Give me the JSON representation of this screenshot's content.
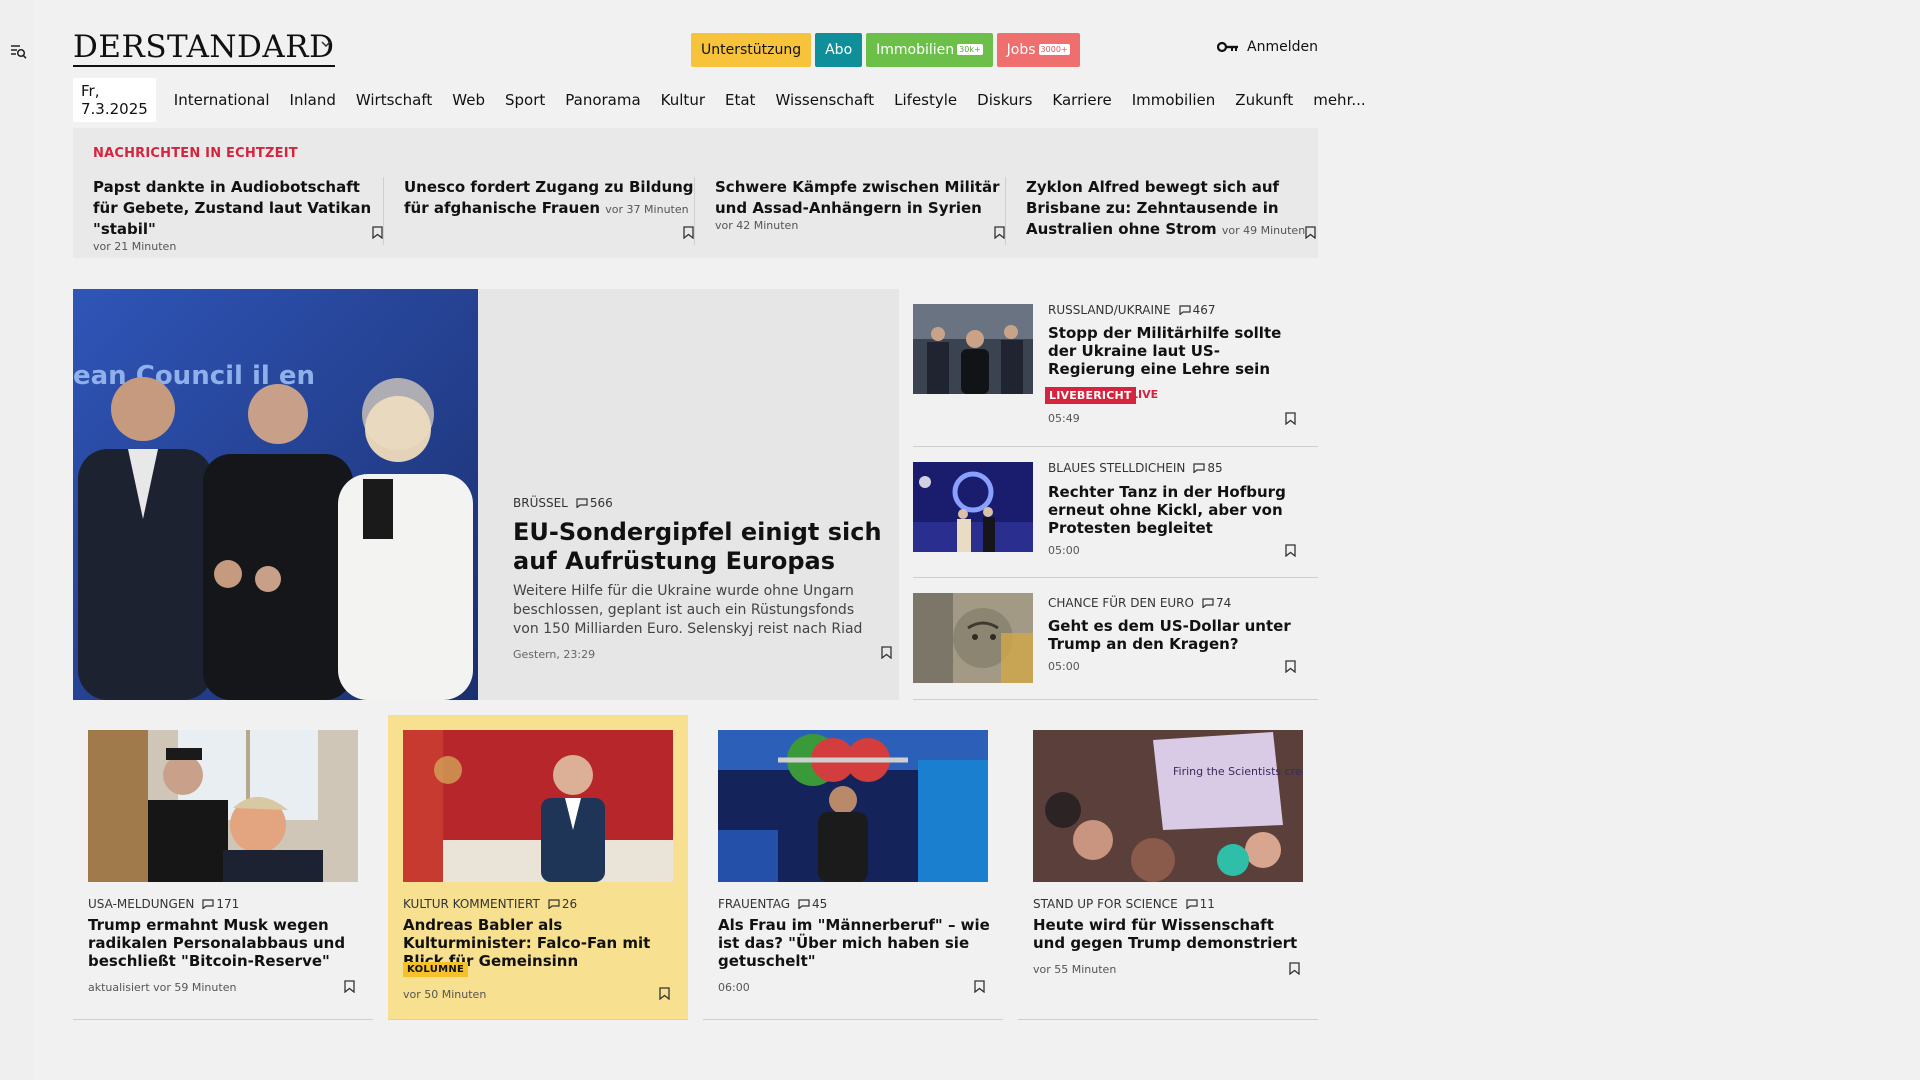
{
  "header": {
    "logo": "DERSTANDARD",
    "pills": {
      "support": "Unterstützung",
      "abo": "Abo",
      "immobilien": "Immobilien",
      "immobilien_badge": "30k+",
      "jobs": "Jobs",
      "jobs_badge": "3000+"
    },
    "login": "Anmelden"
  },
  "nav": {
    "date": "Fr, 7.3.2025",
    "items": [
      "International",
      "Inland",
      "Wirtschaft",
      "Web",
      "Sport",
      "Panorama",
      "Kultur",
      "Etat",
      "Wissenschaft",
      "Lifestyle",
      "Diskurs",
      "Karriere",
      "Immobilien",
      "Zukunft",
      "mehr..."
    ]
  },
  "ticker": {
    "label": "NACHRICHTEN IN ECHTZEIT",
    "items": [
      {
        "headline": "Papst dankte in Audiobotschaft für Gebete, Zustand laut Vatikan \"stabil\"",
        "time": "vor 21 Minuten"
      },
      {
        "headline": "Unesco fordert Zugang zu Bildung für afghanische Frauen",
        "time": "vor 37 Minuten"
      },
      {
        "headline": "Schwere Kämpfe zwischen Militär und Assad-Anhängern in Syrien",
        "time": "vor 42 Minuten"
      },
      {
        "headline": "Zyklon Alfred bewegt sich auf Brisbane zu: Zehntausende in Australien ohne Strom",
        "time": "vor 49 Minuten"
      }
    ]
  },
  "hero": {
    "kicker": "BRÜSSEL",
    "comments": "566",
    "title": "EU-Sondergipfel einigt sich auf Aufrüstung Europas",
    "lead": "Weitere Hilfe für die Ukraine wurde ohne Ungarn beschlossen, geplant ist auch ein Rüstungsfonds von 150 Milliarden Euro. Selenskyj reist nach Riad",
    "time": "Gestern, 23:29",
    "image_text": "ean Council il en"
  },
  "side": [
    {
      "kicker": "RUSSLAND/UKRAINE",
      "comments": "467",
      "title": "Stopp der Militärhilfe sollte der Ukraine laut US-Regierung eine Lehre sein",
      "badge": "LIVEBERICHT",
      "live": "LIVE",
      "time": "05:49"
    },
    {
      "kicker": "BLAUES STELLDICHEIN",
      "comments": "85",
      "title": "Rechter Tanz in der Hofburg erneut ohne Kickl, aber von Protesten begleitet",
      "time": "05:00"
    },
    {
      "kicker": "CHANCE FÜR DEN EURO",
      "comments": "74",
      "title": "Geht es dem US-Dollar unter Trump an den Kragen?",
      "time": "05:00"
    }
  ],
  "cards": [
    {
      "kicker": "USA-MELDUNGEN",
      "comments": "171",
      "title": "Trump ermahnt Musk wegen radikalen Personalabbaus und beschließt \"Bitcoin-Reserve\"",
      "meta": "aktualisiert vor 59 Minuten"
    },
    {
      "kicker": "KULTUR KOMMENTIERT",
      "comments": "26",
      "title": "Andreas Babler als Kulturminister: Falco-Fan mit Blick für Gemeinsinn",
      "badge": "KOLUMNE",
      "meta": "vor 50 Minuten"
    },
    {
      "kicker": "FRAUENTAG",
      "comments": "45",
      "title": "Als Frau im \"Männerberuf\" – wie ist das? \"Über mich haben sie getuschelt\"",
      "meta": "06:00"
    },
    {
      "kicker": "STAND UP FOR SCIENCE",
      "comments": "11",
      "title": "Heute wird für Wissenschaft und gegen Trump demonstriert",
      "meta": "vor 55 Minuten",
      "sign_text": "Firing the Scientists creates a SHIT STORM"
    }
  ],
  "colors": {
    "accent_red": "#d6243f",
    "yellow": "#f7c33b",
    "teal": "#0f8f99",
    "green": "#6cc04a",
    "jobs_red": "#ef6f6f",
    "highlight": "#f7e08f"
  }
}
